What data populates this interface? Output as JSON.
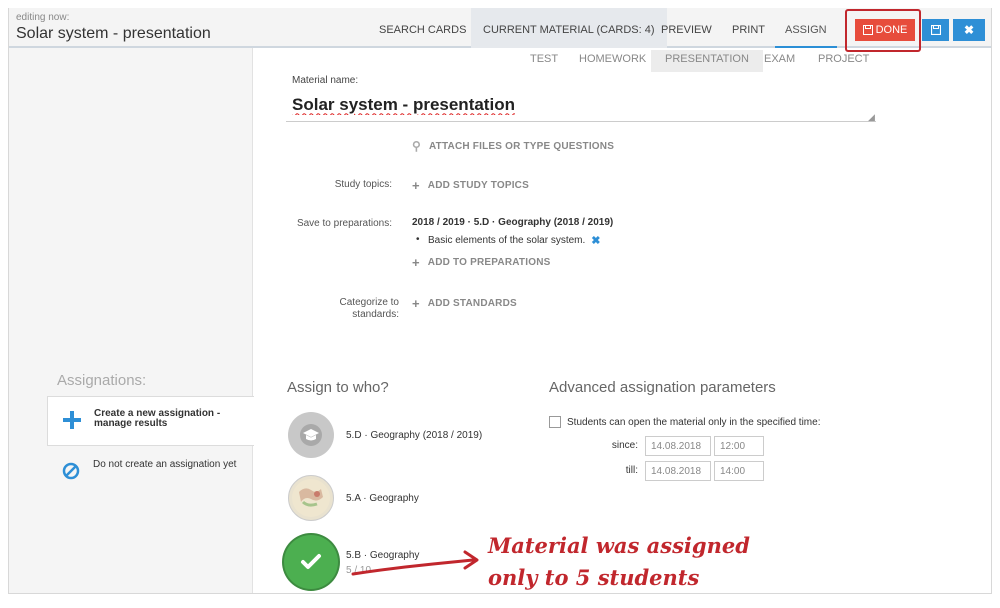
{
  "header": {
    "editing_now": "editing now:",
    "title": "Solar system - presentation",
    "tabs": [
      "SEARCH CARDS",
      "CURRENT MATERIAL (CARDS: 4)",
      "PREVIEW",
      "PRINT",
      "ASSIGN"
    ],
    "active_tab": "ASSIGN",
    "done_label": "DONE",
    "colors": {
      "done": "#e74c3c",
      "primary": "#2e8fd6",
      "highlight": "#c1272d"
    }
  },
  "material_types": [
    "TEST",
    "HOMEWORK",
    "PRESENTATION",
    "EXAM",
    "PROJECT"
  ],
  "selected_material_type": "PRESENTATION",
  "form": {
    "name_label": "Material name:",
    "name_value": "Solar system - presentation",
    "attach_label": "ATTACH FILES OR TYPE QUESTIONS",
    "study_topics_label": "Study topics:",
    "add_study_topics": "ADD STUDY TOPICS",
    "save_to_label": "Save to preparations:",
    "preparation": "2018 / 2019 · 5.D · Geography (2018 / 2019)",
    "preparation_topic": "Basic elements of the solar system.",
    "add_preparations": "ADD TO PREPARATIONS",
    "categorize_label": "Categorize to standards:",
    "add_standards": "ADD STANDARDS"
  },
  "sidebar": {
    "heading": "Assignations:",
    "items": [
      {
        "label": "Create a new assignation - manage results",
        "icon": "plus-icon",
        "selected": true
      },
      {
        "label": "Do not create an assignation yet",
        "icon": "ban-icon",
        "selected": false
      }
    ]
  },
  "assign": {
    "heading": "Assign to who?",
    "classes": [
      {
        "name": "5.D · Geography (2018 / 2019)",
        "progress": "",
        "icon": "graduation-cap-icon"
      },
      {
        "name": "5.A · Geography",
        "progress": "",
        "icon": "class-map-icon"
      },
      {
        "name": "5.B · Geography",
        "progress": "5 / 10",
        "icon": "check-icon"
      }
    ]
  },
  "advanced": {
    "heading": "Advanced assignation parameters",
    "checkbox_label": "Students can open the material only in the specified time:",
    "since_label": "since:",
    "since_date": "14.08.2018",
    "since_time": "12:00",
    "till_label": "till:",
    "till_date": "14.08.2018",
    "till_time": "14:00"
  },
  "annotation": {
    "line1": "Material was assigned",
    "line2": "only to 5 students"
  }
}
